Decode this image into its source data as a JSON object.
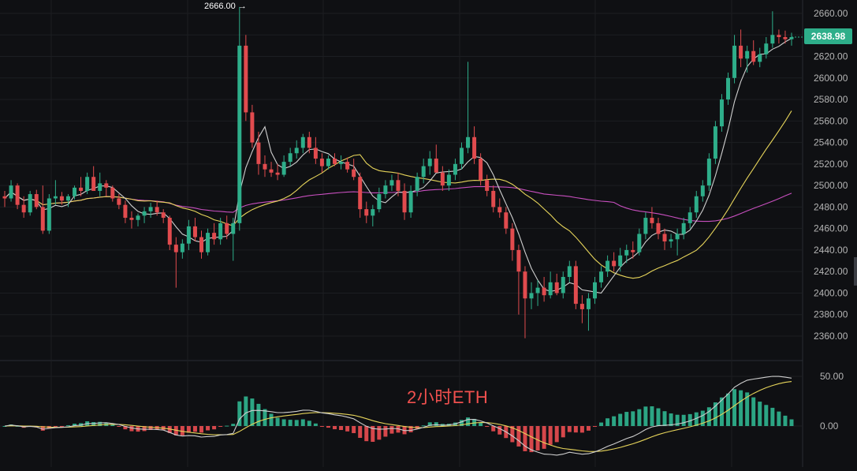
{
  "overlay_title": "2小时ETH",
  "last_price_tag": "2638.98",
  "max_marker": "2666.00",
  "colors": {
    "up": "#2eae8a",
    "down": "#e14b4e",
    "ma_white": "#cfcfcf",
    "ma_yellow": "#e6d45a",
    "ma_magenta": "#c84fbf",
    "grid": "#1c1e22",
    "axis_text": "#b5b5b5",
    "background": "#0f1013"
  },
  "chart_data": [
    {
      "type": "candlestick",
      "y_ticks": [
        "2660.00",
        "2640.00",
        "2620.00",
        "2600.00",
        "2580.00",
        "2560.00",
        "2540.00",
        "2520.00",
        "2500.00",
        "2480.00",
        "2460.00",
        "2440.00",
        "2420.00",
        "2400.00",
        "2380.00",
        "2360.00"
      ],
      "ylim": [
        2350,
        2670
      ],
      "candles": [
        [
          2490,
          2495,
          2480,
          2488
        ],
        [
          2488,
          2505,
          2485,
          2500
        ],
        [
          2500,
          2502,
          2478,
          2482
        ],
        [
          2482,
          2490,
          2470,
          2475
        ],
        [
          2475,
          2495,
          2472,
          2492
        ],
        [
          2492,
          2496,
          2478,
          2480
        ],
        [
          2480,
          2500,
          2455,
          2458
        ],
        [
          2458,
          2492,
          2455,
          2488
        ],
        [
          2488,
          2505,
          2482,
          2490
        ],
        [
          2490,
          2494,
          2482,
          2486
        ],
        [
          2486,
          2492,
          2480,
          2490
        ],
        [
          2490,
          2500,
          2487,
          2498
        ],
        [
          2498,
          2508,
          2490,
          2495
        ],
        [
          2495,
          2512,
          2492,
          2508
        ],
        [
          2508,
          2518,
          2500,
          2495
        ],
        [
          2495,
          2512,
          2490,
          2502
        ],
        [
          2502,
          2505,
          2490,
          2498
        ],
        [
          2498,
          2500,
          2485,
          2488
        ],
        [
          2488,
          2492,
          2478,
          2482
        ],
        [
          2482,
          2486,
          2465,
          2470
        ],
        [
          2470,
          2476,
          2460,
          2468
        ],
        [
          2468,
          2474,
          2462,
          2472
        ],
        [
          2472,
          2480,
          2465,
          2476
        ],
        [
          2476,
          2484,
          2470,
          2480
        ],
        [
          2480,
          2486,
          2472,
          2475
        ],
        [
          2475,
          2478,
          2465,
          2470
        ],
        [
          2470,
          2472,
          2440,
          2445
        ],
        [
          2445,
          2452,
          2405,
          2438
        ],
        [
          2438,
          2450,
          2432,
          2446
        ],
        [
          2446,
          2468,
          2440,
          2462
        ],
        [
          2462,
          2470,
          2448,
          2452
        ],
        [
          2452,
          2458,
          2432,
          2438
        ],
        [
          2438,
          2460,
          2435,
          2456
        ],
        [
          2456,
          2465,
          2445,
          2450
        ],
        [
          2450,
          2470,
          2445,
          2465
        ],
        [
          2465,
          2472,
          2450,
          2455
        ],
        [
          2455,
          2470,
          2430,
          2465
        ],
        [
          2465,
          2666,
          2458,
          2630
        ],
        [
          2630,
          2640,
          2560,
          2568
        ],
        [
          2568,
          2575,
          2535,
          2540
        ],
        [
          2540,
          2550,
          2510,
          2520
        ],
        [
          2520,
          2528,
          2508,
          2515
        ],
        [
          2515,
          2522,
          2508,
          2512
        ],
        [
          2512,
          2520,
          2505,
          2510
        ],
        [
          2510,
          2528,
          2508,
          2522
        ],
        [
          2522,
          2535,
          2518,
          2530
        ],
        [
          2530,
          2542,
          2525,
          2535
        ],
        [
          2535,
          2548,
          2530,
          2545
        ],
        [
          2545,
          2550,
          2530,
          2535
        ],
        [
          2535,
          2545,
          2520,
          2525
        ],
        [
          2525,
          2530,
          2512,
          2518
        ],
        [
          2518,
          2528,
          2515,
          2525
        ],
        [
          2525,
          2530,
          2518,
          2520
        ],
        [
          2520,
          2528,
          2515,
          2522
        ],
        [
          2522,
          2526,
          2512,
          2515
        ],
        [
          2515,
          2525,
          2505,
          2508
        ],
        [
          2508,
          2512,
          2470,
          2478
        ],
        [
          2478,
          2485,
          2465,
          2472
        ],
        [
          2472,
          2482,
          2462,
          2478
        ],
        [
          2478,
          2498,
          2475,
          2492
        ],
        [
          2492,
          2505,
          2488,
          2500
        ],
        [
          2500,
          2510,
          2495,
          2505
        ],
        [
          2505,
          2512,
          2490,
          2495
        ],
        [
          2495,
          2502,
          2468,
          2475
        ],
        [
          2475,
          2500,
          2470,
          2495
        ],
        [
          2495,
          2512,
          2490,
          2508
        ],
        [
          2508,
          2525,
          2502,
          2518
        ],
        [
          2518,
          2532,
          2510,
          2525
        ],
        [
          2525,
          2538,
          2518,
          2512
        ],
        [
          2512,
          2518,
          2495,
          2500
        ],
        [
          2500,
          2515,
          2495,
          2510
        ],
        [
          2510,
          2525,
          2505,
          2520
        ],
        [
          2520,
          2540,
          2515,
          2535
        ],
        [
          2535,
          2615,
          2530,
          2545
        ],
        [
          2545,
          2555,
          2520,
          2525
        ],
        [
          2525,
          2530,
          2500,
          2505
        ],
        [
          2505,
          2510,
          2490,
          2495
        ],
        [
          2495,
          2500,
          2475,
          2480
        ],
        [
          2480,
          2488,
          2470,
          2475
        ],
        [
          2475,
          2480,
          2455,
          2460
        ],
        [
          2460,
          2465,
          2430,
          2440
        ],
        [
          2440,
          2445,
          2380,
          2420
        ],
        [
          2420,
          2425,
          2358,
          2395
        ],
        [
          2395,
          2410,
          2385,
          2400
        ],
        [
          2400,
          2412,
          2388,
          2405
        ],
        [
          2405,
          2415,
          2392,
          2398
        ],
        [
          2398,
          2420,
          2395,
          2410
        ],
        [
          2410,
          2418,
          2398,
          2400
        ],
        [
          2400,
          2420,
          2395,
          2415
        ],
        [
          2415,
          2430,
          2410,
          2425
        ],
        [
          2425,
          2430,
          2385,
          2390
        ],
        [
          2390,
          2398,
          2372,
          2385
        ],
        [
          2385,
          2400,
          2365,
          2395
        ],
        [
          2395,
          2415,
          2390,
          2410
        ],
        [
          2410,
          2425,
          2405,
          2420
        ],
        [
          2420,
          2435,
          2415,
          2430
        ],
        [
          2430,
          2438,
          2420,
          2425
        ],
        [
          2425,
          2442,
          2420,
          2435
        ],
        [
          2435,
          2445,
          2428,
          2440
        ],
        [
          2440,
          2448,
          2432,
          2438
        ],
        [
          2438,
          2460,
          2435,
          2455
        ],
        [
          2455,
          2475,
          2450,
          2470
        ],
        [
          2470,
          2480,
          2460,
          2465
        ],
        [
          2465,
          2470,
          2450,
          2455
        ],
        [
          2455,
          2460,
          2440,
          2448
        ],
        [
          2448,
          2455,
          2442,
          2450
        ],
        [
          2450,
          2460,
          2435,
          2455
        ],
        [
          2455,
          2470,
          2450,
          2465
        ],
        [
          2465,
          2480,
          2460,
          2475
        ],
        [
          2475,
          2495,
          2470,
          2490
        ],
        [
          2490,
          2505,
          2485,
          2500
        ],
        [
          2500,
          2530,
          2495,
          2525
        ],
        [
          2525,
          2560,
          2520,
          2555
        ],
        [
          2555,
          2585,
          2550,
          2580
        ],
        [
          2580,
          2605,
          2575,
          2600
        ],
        [
          2600,
          2640,
          2595,
          2630
        ],
        [
          2630,
          2645,
          2610,
          2618
        ],
        [
          2618,
          2630,
          2605,
          2625
        ],
        [
          2625,
          2635,
          2612,
          2615
        ],
        [
          2615,
          2628,
          2610,
          2622
        ],
        [
          2622,
          2638,
          2618,
          2632
        ],
        [
          2632,
          2662,
          2628,
          2640
        ],
        [
          2640,
          2645,
          2632,
          2638
        ],
        [
          2638,
          2644,
          2632,
          2636
        ],
        [
          2636,
          2642,
          2630,
          2638
        ]
      ]
    },
    {
      "type": "histogram",
      "y_ticks": [
        "50.00",
        "0.00"
      ],
      "ylim": [
        -30,
        60
      ]
    }
  ]
}
